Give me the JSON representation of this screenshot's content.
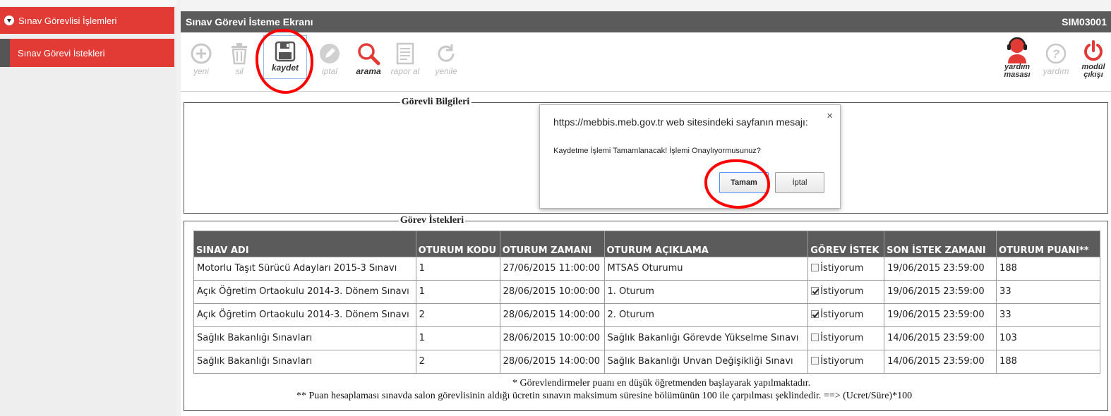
{
  "sidebar": {
    "main_item": "Sınav Görevlisi İşlemleri",
    "sub_item": "Sınav Görevi İstekleri"
  },
  "header": {
    "title": "Sınav Görevi İsteme Ekranı",
    "code": "SIM03001"
  },
  "toolbar": {
    "yeni": "yeni",
    "sil": "sil",
    "kaydet": "kaydet",
    "iptal": "iptal",
    "arama": "arama",
    "rapor_al": "rapor al",
    "yenile": "yenile",
    "yardim_masasi_1": "yardım",
    "yardim_masasi_2": "masası",
    "yardim": "yardım",
    "modul_cikisi_1": "modül",
    "modul_cikisi_2": "çıkışı"
  },
  "sections": {
    "gorevli_bilgileri": "Görevli Bilgileri",
    "gorev_istekleri": "Görev İstekleri"
  },
  "table": {
    "headers": [
      "SINAV ADI",
      "OTURUM KODU",
      "OTURUM ZAMANI",
      "OTURUM AÇIKLAMA",
      "GÖREV İSTEK",
      "SON İSTEK ZAMANI",
      "OTURUM PUANI**"
    ],
    "rows": [
      {
        "sinav": "Motorlu Taşıt Sürücü Adayları 2015-3 Sınavı",
        "kod": "1",
        "zaman": "27/06/2015 11:00:00",
        "aciklama": "MTSAS Oturumu",
        "istek": false,
        "istek_label": "İstiyorum",
        "son": "19/06/2015 23:59:00",
        "puan": "188"
      },
      {
        "sinav": "Açık Öğretim Ortaokulu 2014-3. Dönem Sınavı",
        "kod": "1",
        "zaman": "28/06/2015 10:00:00",
        "aciklama": "1. Oturum",
        "istek": true,
        "istek_label": "İstiyorum",
        "son": "19/06/2015 23:59:00",
        "puan": "33"
      },
      {
        "sinav": "Açık Öğretim Ortaokulu 2014-3. Dönem Sınavı",
        "kod": "2",
        "zaman": "28/06/2015 14:00:00",
        "aciklama": "2. Oturum",
        "istek": true,
        "istek_label": "İstiyorum",
        "son": "19/06/2015 23:59:00",
        "puan": "33"
      },
      {
        "sinav": "Sağlık Bakanlığı Sınavları",
        "kod": "1",
        "zaman": "28/06/2015 10:00:00",
        "aciklama": "Sağlık Bakanlığı Görevde Yükselme Sınavı",
        "istek": false,
        "istek_label": "İstiyorum",
        "son": "14/06/2015 23:59:00",
        "puan": "103"
      },
      {
        "sinav": "Sağlık Bakanlığı Sınavları",
        "kod": "2",
        "zaman": "28/06/2015 14:00:00",
        "aciklama": "Sağlık Bakanlığı Unvan Değişikliği Sınavı",
        "istek": false,
        "istek_label": "İstiyorum",
        "son": "14/06/2015 23:59:00",
        "puan": "188"
      }
    ]
  },
  "notes": {
    "note1": "*  Görevlendirmeler puanı en düşük öğretmenden başlayarak yapılmaktadır.",
    "note2": "** Puan hesaplaması sınavda salon görevlisinin aldığı ücretin sınavın maksimum süresine bölümünün 100 ile çarpılması şeklindedir. ==> (Ucret/Süre)*100"
  },
  "dialog": {
    "title": "https://mebbis.meb.gov.tr web sitesindeki sayfanın mesajı:",
    "message": "Kaydetme İşlemi Tamamlanacak! İşlemi Onaylıyormusunuz?",
    "ok_label": "Tamam",
    "cancel_label": "İptal",
    "close_symbol": "×"
  },
  "colors": {
    "menu_red": "#e23b36",
    "title_gray": "#5b5b5b",
    "annotation_red": "#ff0000"
  }
}
